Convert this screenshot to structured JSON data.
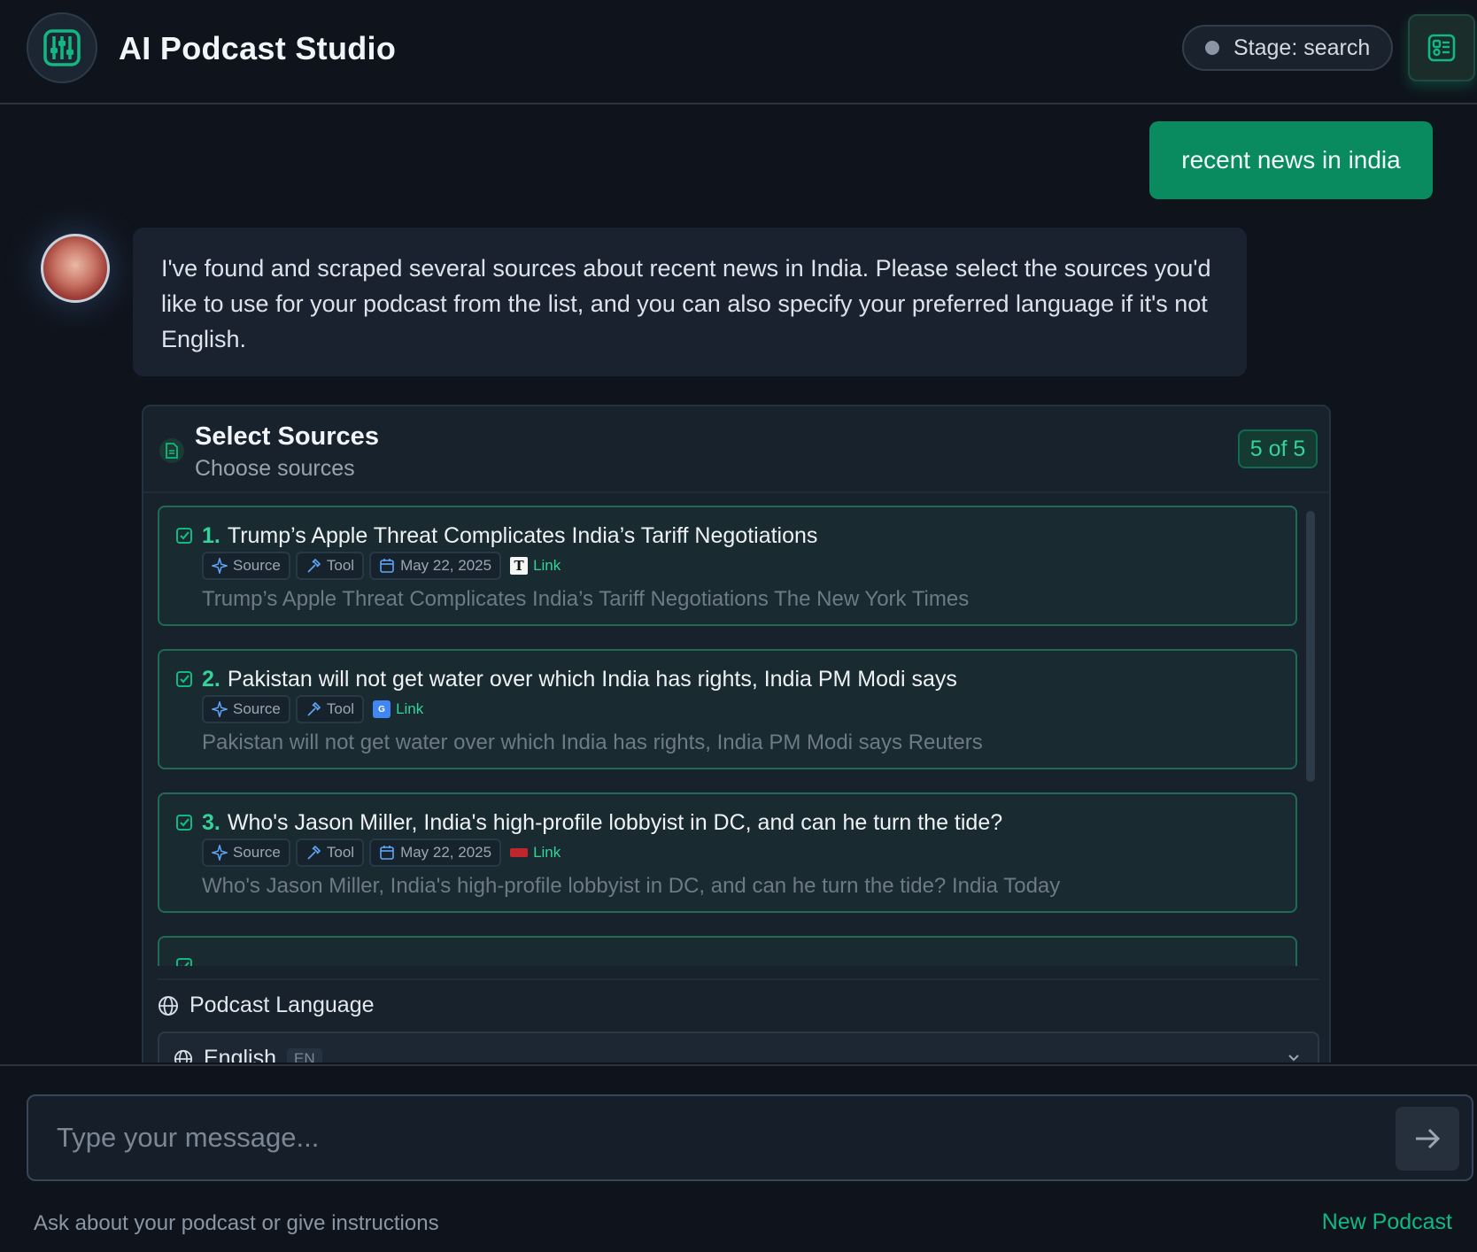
{
  "header": {
    "title": "AI Podcast Studio",
    "stage_label": "Stage: search",
    "logo_icon": "equalizer-sliders-icon",
    "top_button_icon": "panel-list-icon"
  },
  "chat": {
    "user_message": "recent news in india",
    "assistant_message": "I've found and scraped several sources about recent news in India. Please select the sources you'd like to use for your podcast from the list, and you can also specify your preferred language if it's not English."
  },
  "sources_card": {
    "title": "Select Sources",
    "subtitle": "Choose sources",
    "count": "5 of 5",
    "tag_source": "Source",
    "tag_tool": "Tool",
    "link_label": "Link",
    "items": [
      {
        "num": "1.",
        "title": "Trump’s Apple Threat Complicates India’s Tariff Negotiations",
        "date": "May 22, 2025",
        "description": "Trump’s Apple Threat Complicates India’s Tariff Negotiations The New York Times",
        "favicon": "nyt-favicon-icon"
      },
      {
        "num": "2.",
        "title": "Pakistan will not get water over which India has rights, India PM Modi says",
        "date": "",
        "description": "Pakistan will not get water over which India has rights, India PM Modi says Reuters",
        "favicon": "google-news-favicon-icon"
      },
      {
        "num": "3.",
        "title": "Who's Jason Miller, India's high-profile lobbyist in DC, and can he turn the tide?",
        "date": "May 22, 2025",
        "description": "Who's Jason Miller, India's high-profile lobbyist in DC, and can he turn the tide? India Today",
        "favicon": "india-today-favicon-icon"
      }
    ],
    "language_label": "Podcast Language",
    "language_value": "English",
    "language_code": "EN"
  },
  "footer": {
    "input_placeholder": "Type your message...",
    "hint": "Ask about your podcast or give instructions",
    "new_podcast": "New Podcast"
  },
  "colors": {
    "accent": "#10b981",
    "user_bubble": "#0a8a5f",
    "background": "#0f141c"
  }
}
